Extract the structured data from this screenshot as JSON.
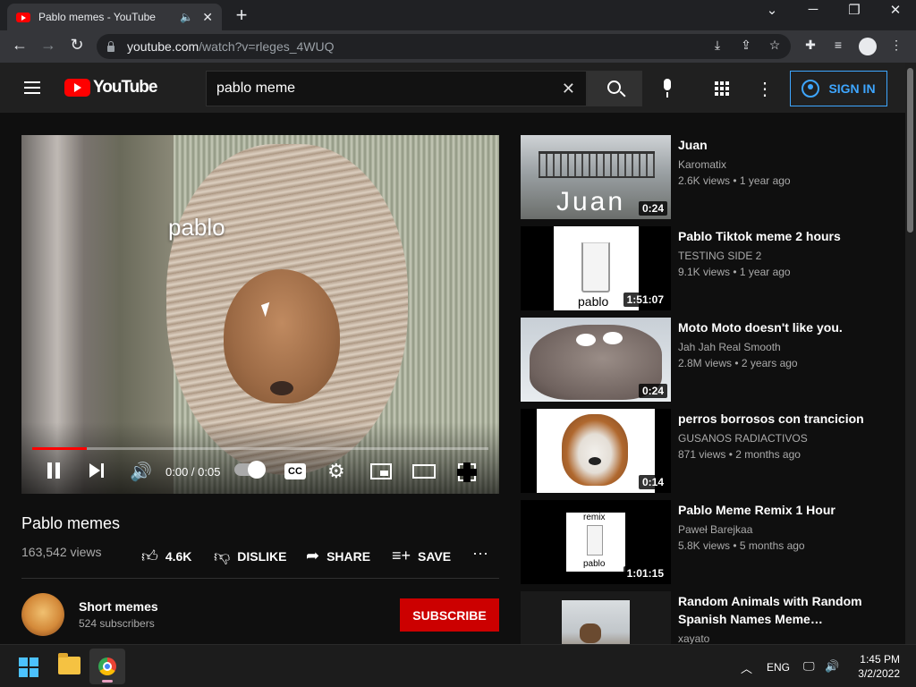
{
  "browser": {
    "tab_title": "Pablo memes - YouTube",
    "url_host": "youtube.com",
    "url_path": "/watch?v=rleges_4WUQ"
  },
  "youtube": {
    "logo_text": "YouTube",
    "search_query": "pablo meme",
    "sign_in_label": "SIGN IN"
  },
  "player": {
    "caption_overlay": "pablo",
    "time": "0:00 / 0:05",
    "progress_fraction": 0.12,
    "cc_label": "CC"
  },
  "video": {
    "title": "Pablo memes",
    "views": "163,542 views",
    "actions": {
      "like": "4.6K",
      "dislike": "DISLIKE",
      "share": "SHARE",
      "save": "SAVE"
    },
    "channel": {
      "name": "Short memes",
      "subscribers": "524 subscribers",
      "subscribe_label": "SUBSCRIBE"
    }
  },
  "recommendations": [
    {
      "title": "Juan",
      "channel": "Karomatix",
      "meta": "2.6K views • 1 year ago",
      "duration": "0:24",
      "thumb_text": "Juan"
    },
    {
      "title": "Pablo Tiktok meme 2 hours",
      "channel": "TESTING SIDE 2",
      "meta": "9.1K views • 1 year ago",
      "duration": "1:51:07",
      "thumb_text": "pablo"
    },
    {
      "title": "Moto Moto doesn't like you.",
      "channel": "Jah Jah Real Smooth",
      "meta": "2.8M views • 2 years ago",
      "duration": "0:24",
      "thumb_text": ""
    },
    {
      "title": "perros borrosos con trancicion",
      "channel": "GUSANOS RADIACTIVOS",
      "meta": "871 views • 2 months ago",
      "duration": "0:14",
      "thumb_text": ""
    },
    {
      "title": "Pablo Meme Remix 1 Hour",
      "channel": "Paweł Barejkaa",
      "meta": "5.8K views • 5 months ago",
      "duration": "1:01:15",
      "thumb_text_top": "remix",
      "thumb_text": "pablo"
    },
    {
      "title": "Random Animals with Random Spanish Names Meme…",
      "channel": "xayato",
      "meta": "",
      "duration": "",
      "thumb_text": ""
    }
  ],
  "taskbar": {
    "language": "ENG",
    "time": "1:45 PM",
    "date": "3/2/2022"
  }
}
